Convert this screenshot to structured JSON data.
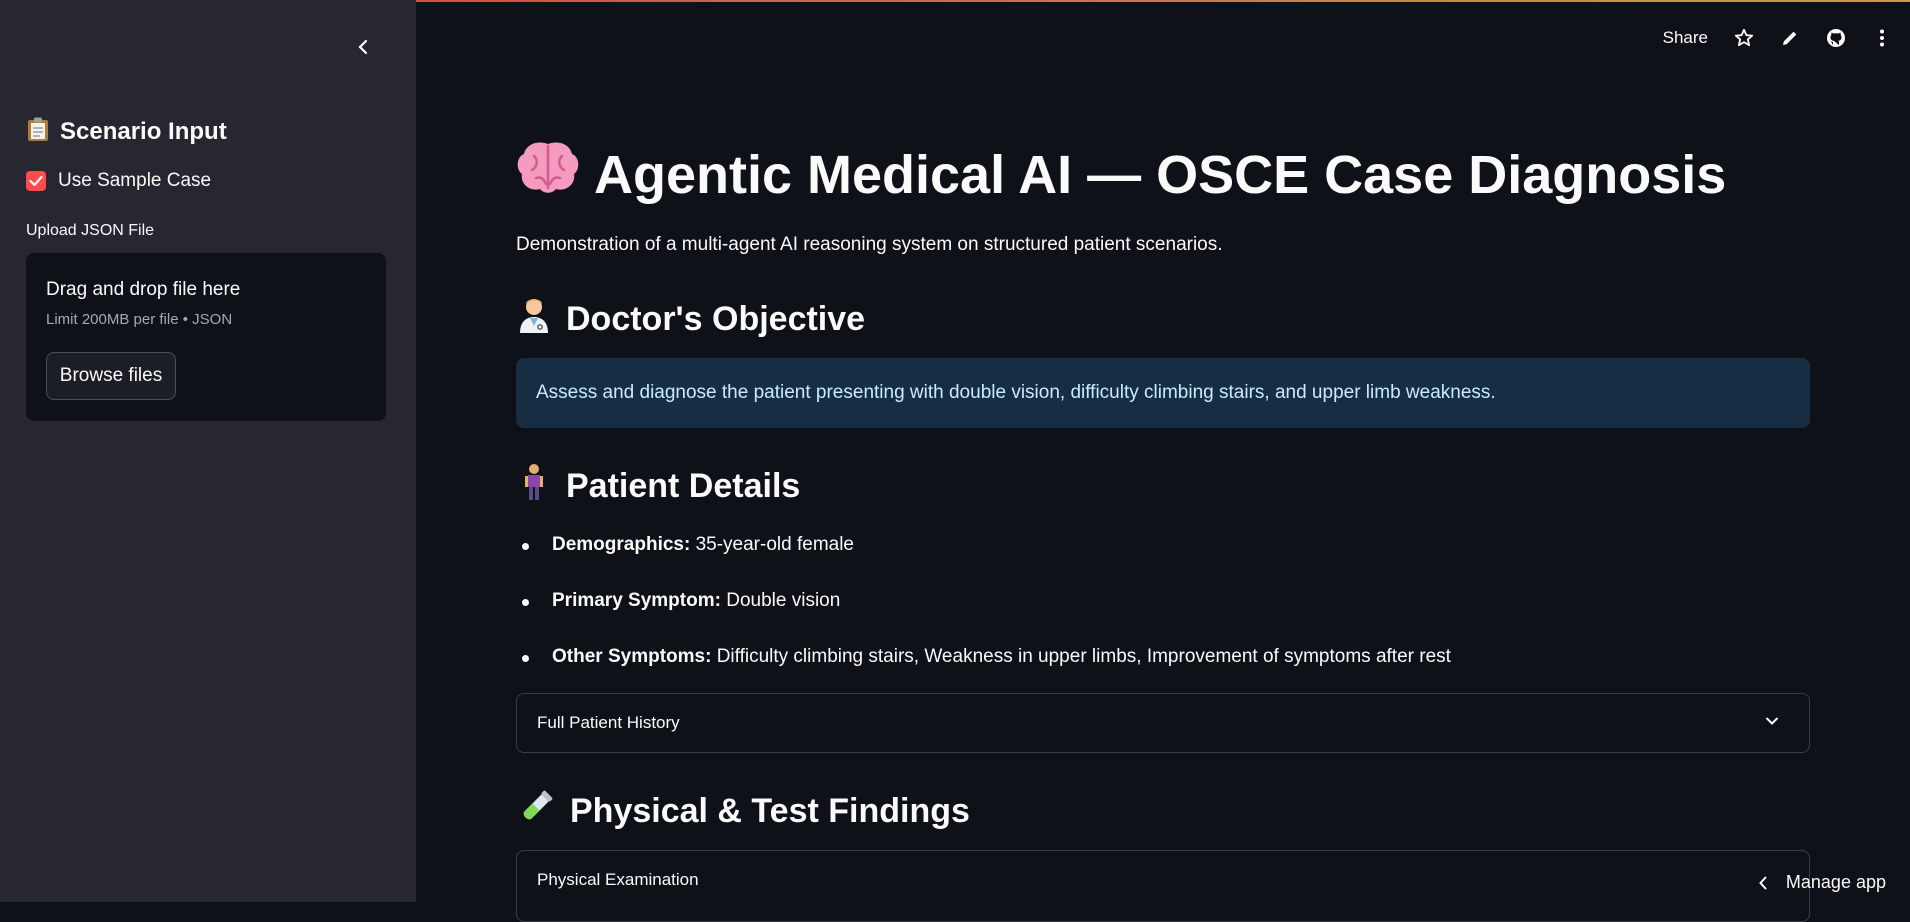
{
  "sidebar": {
    "title": "Scenario Input",
    "title_icon": "clipboard-icon",
    "checkbox_label": "Use Sample Case",
    "checkbox_checked": true,
    "upload_label": "Upload JSON File",
    "dropzone_title": "Drag and drop file here",
    "dropzone_subtitle": "Limit 200MB per file • JSON",
    "browse_label": "Browse files"
  },
  "toolbar": {
    "share_label": "Share",
    "icons": [
      "star-icon",
      "pencil-icon",
      "github-icon",
      "more-vertical-icon"
    ]
  },
  "main": {
    "title": "Agentic Medical AI — OSCE Case Diagnosis",
    "title_icon": "brain-icon",
    "subtitle": "Demonstration of a multi-agent AI reasoning system on structured patient scenarios.",
    "objective_heading": "Doctor's Objective",
    "objective_text": "Assess and diagnose the patient presenting with double vision, difficulty climbing stairs, and upper limb weakness.",
    "patient_heading": "Patient Details",
    "patient_items": [
      {
        "label": "Demographics:",
        "value": " 35-year-old female"
      },
      {
        "label": "Primary Symptom:",
        "value": " Double vision"
      },
      {
        "label": "Other Symptoms:",
        "value": " Difficulty climbing stairs, Weakness in upper limbs, Improvement of symptoms after rest"
      }
    ],
    "history_expander": "Full Patient History",
    "findings_heading": "Physical & Test Findings",
    "exam_expander": "Physical Examination"
  },
  "footer": {
    "manage_label": "Manage app"
  },
  "colors": {
    "accent": "#ff4b4b",
    "sidebar_bg": "#262730",
    "main_bg": "#0e1117",
    "info_bg": "#172d43",
    "info_text": "#c7ebff"
  }
}
